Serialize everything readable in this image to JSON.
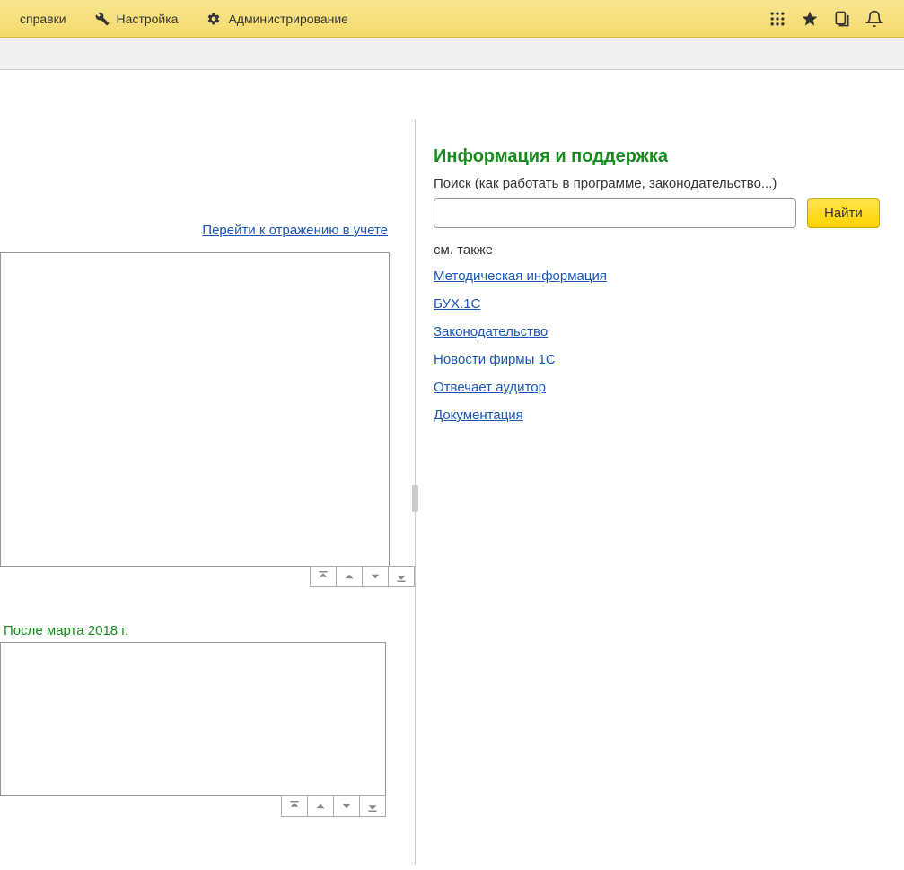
{
  "menu": {
    "item1": "справки",
    "item2": "Настройка",
    "item3": "Администрирование"
  },
  "left": {
    "reflect_link": "Перейти к отражению в учете",
    "box2_label": "После марта 2018 г."
  },
  "support": {
    "title": "Информация и поддержка",
    "search_label": "Поиск (как работать в программе, законодательство...)",
    "find_button": "Найти",
    "see_also": "см. также",
    "links": {
      "l1": "Методическая информация",
      "l2": "БУХ.1С",
      "l3": "Законодательство",
      "l4": "Новости фирмы 1С",
      "l5": "Отвечает аудитор",
      "l6": "Документация"
    }
  }
}
